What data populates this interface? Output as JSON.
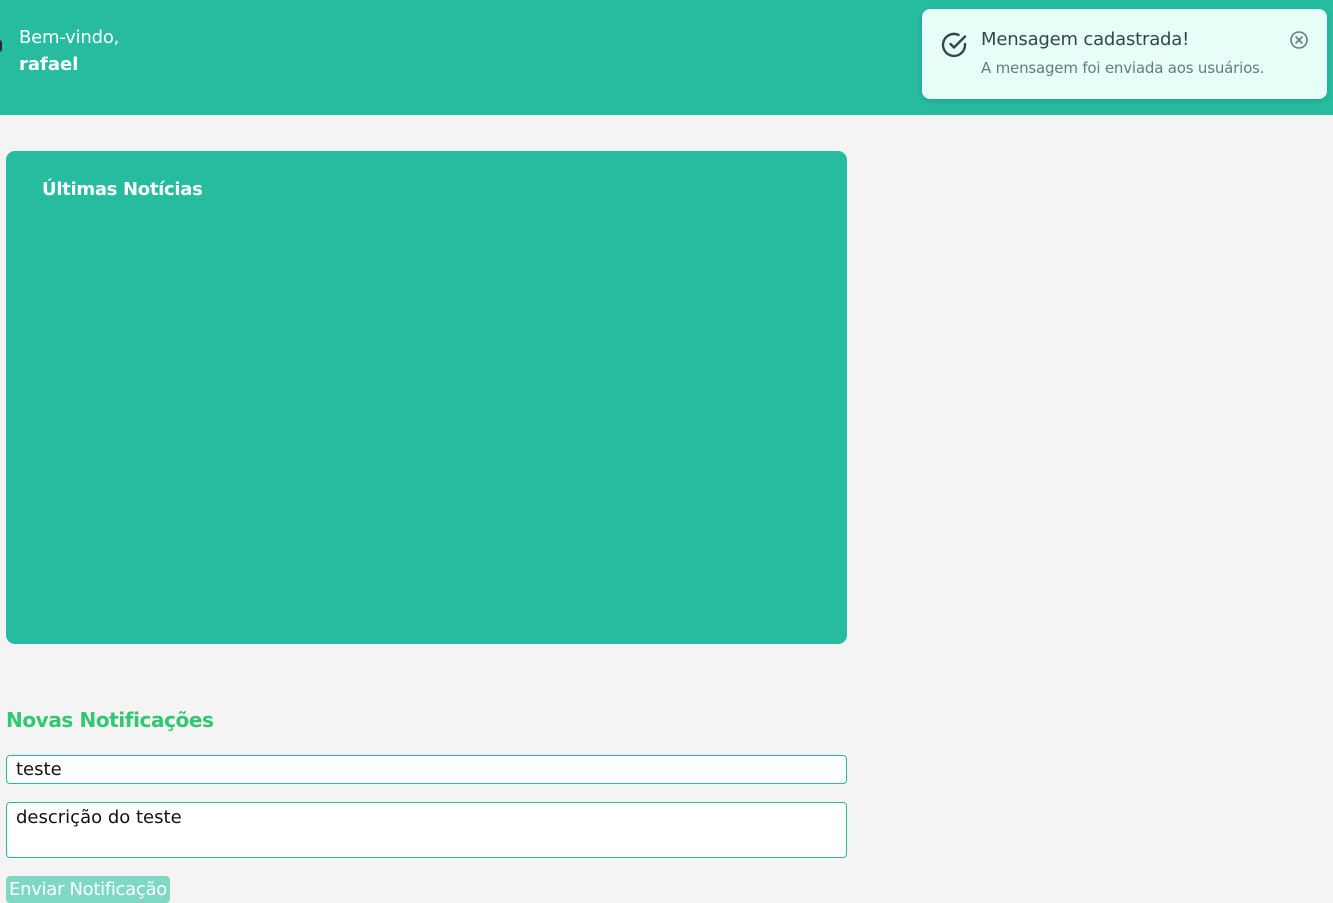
{
  "header": {
    "greeting": "Bem-vindo,",
    "username": "rafael",
    "background_color": "#27bba0"
  },
  "toast": {
    "title": "Mensagem cadastrada!",
    "message": "A mensagem foi enviada aos usuários.",
    "icon": "check-circle-icon",
    "close_icon": "close-circle-icon",
    "background_color": "#e6fdf8"
  },
  "news": {
    "title": "Últimas Notícias",
    "background_color": "#27bba0"
  },
  "notifications": {
    "section_title": "Novas Notificações",
    "title_value": "teste",
    "description_value": "descrição do teste",
    "send_label": "Enviar Notificação",
    "accent_color": "#33c673"
  }
}
